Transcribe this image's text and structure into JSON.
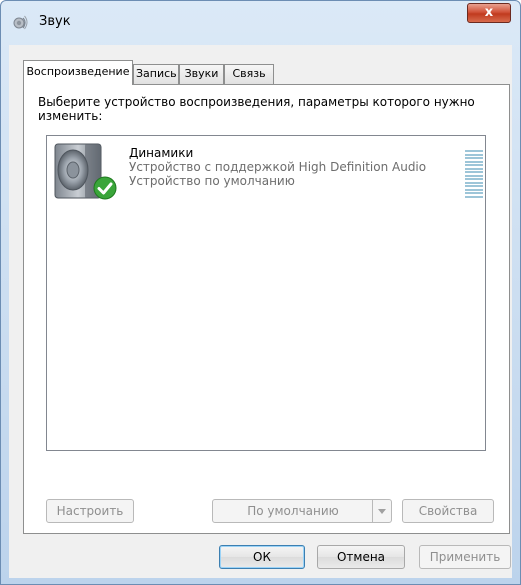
{
  "window": {
    "title": "Звук",
    "close_label": "x"
  },
  "tabs": [
    {
      "label": "Воспроизведение",
      "active": true
    },
    {
      "label": "Запись",
      "active": false
    },
    {
      "label": "Звуки",
      "active": false
    },
    {
      "label": "Связь",
      "active": false
    }
  ],
  "playback": {
    "instruction": "Выберите устройство воспроизведения, параметры которого нужно изменить:",
    "devices": [
      {
        "name": "Динамики",
        "description": "Устройство с поддержкой High Definition Audio",
        "status": "Устройство по умолчанию",
        "icon": "speaker-icon",
        "badge": "default-check-icon"
      }
    ],
    "buttons": {
      "configure": "Настроить",
      "set_default": "По умолчанию",
      "properties": "Свойства"
    }
  },
  "footer": {
    "ok": "ОК",
    "cancel": "Отмена",
    "apply": "Применить"
  },
  "colors": {
    "close_button": "#c7452a",
    "check_badge": "#3aa53a",
    "level_meter": "#9dc5d8",
    "secondary_text": "#6d6d6d"
  }
}
